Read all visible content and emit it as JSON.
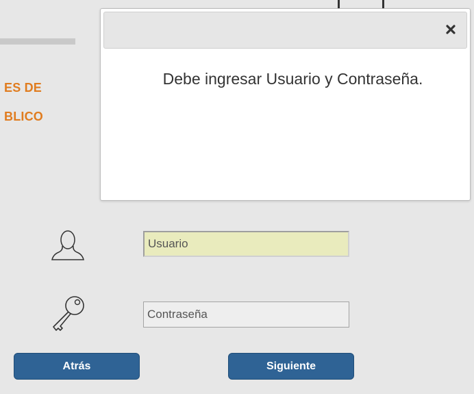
{
  "background": {
    "org_line1": "ES DE",
    "org_line2": "BLICO",
    "accent_color": "#e07c1f"
  },
  "modal": {
    "message": "Debe ingresar Usuario y Contraseña.",
    "close_icon": "close-icon"
  },
  "login": {
    "user_icon": "user-icon",
    "key_icon": "key-icon",
    "username_placeholder": "Usuario",
    "password_placeholder": "Contraseña",
    "back_label": "Atrás",
    "next_label": "Siguiente",
    "button_color": "#2f6395"
  }
}
